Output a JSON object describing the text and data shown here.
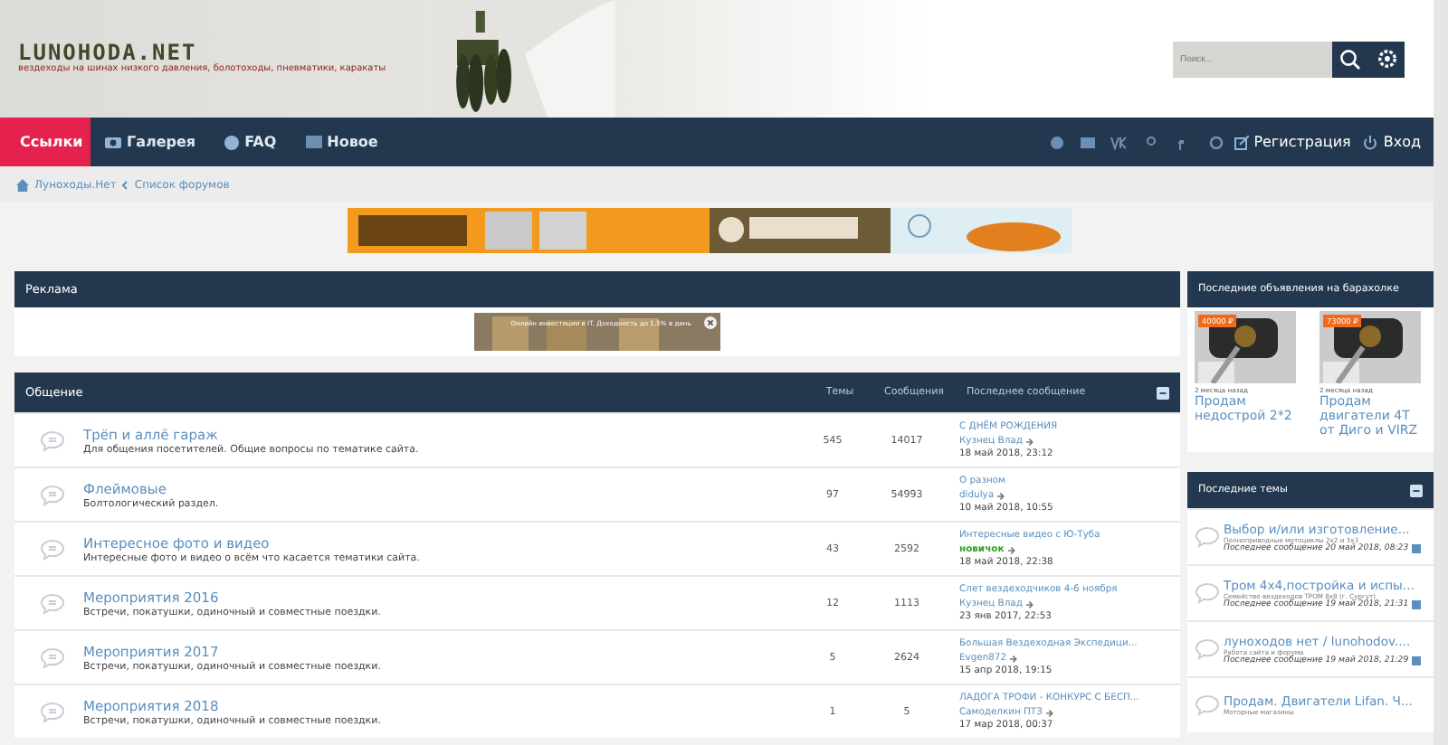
{
  "header": {
    "logo": "LUNOHODA.NET",
    "tagline": "вездеходы на шинах низкого давления, болотоходы, пневматики, каракаты",
    "search": {
      "placeholder": "Поиск..."
    }
  },
  "nav": {
    "items": [
      {
        "label": "Ссылки",
        "selected": true
      },
      {
        "label": "Галерея",
        "selected": false
      },
      {
        "label": "FAQ",
        "selected": false
      },
      {
        "label": "Новое",
        "selected": false
      }
    ],
    "right": [
      {
        "label": "Регистрация"
      },
      {
        "label": "Вход"
      }
    ]
  },
  "breadcrumbs": [
    "Луноходы.Нет",
    "Список форумов"
  ],
  "ads": {
    "title": "Реклама",
    "text": "Онлайн инвестиции в IT. Доходность до 1,5% в день"
  },
  "forum": {
    "title": "Общение",
    "columns": [
      "Темы",
      "Сообщения",
      "Последнее сообщение"
    ],
    "rows": [
      {
        "name": "Трёп и аллё гараж",
        "desc": "Для общения посетителей. Общие вопросы по тематике сайта.",
        "topics": "545",
        "posts": "14017",
        "last": {
          "title": "С ДНЁМ РОЖДЕНИЯ",
          "author": "Кузнец Влад",
          "color": "#5a8fbf",
          "date": "18 май 2018, 23:12"
        }
      },
      {
        "name": "Флеймовые",
        "desc": "Болтологический раздел.",
        "topics": "97",
        "posts": "54993",
        "last": {
          "title": "О разном",
          "author": "didulya",
          "color": "#5a8fbf",
          "date": "10 май 2018, 10:55"
        }
      },
      {
        "name": "Интересное фото и видео",
        "desc": "Интересные фото и видео о всём что касается тематики сайта.",
        "topics": "43",
        "posts": "2592",
        "last": {
          "title": "Интересные видео с Ю-Туба",
          "author": "новичок",
          "color": "#2ea11d",
          "date": "18 май 2018, 22:38"
        }
      },
      {
        "name": "Мероприятия 2016",
        "desc": "Встречи, покатушки, одиночный и совместные поездки.",
        "topics": "12",
        "posts": "1113",
        "last": {
          "title": "Слет вездеходчиков 4-6 ноября",
          "author": "Кузнец Влад",
          "color": "#5a8fbf",
          "date": "23 янв 2017, 22:53"
        }
      },
      {
        "name": "Мероприятия 2017",
        "desc": "Встречи, покатушки, одиночный и совместные поездки.",
        "topics": "5",
        "posts": "2624",
        "last": {
          "title": "Большая Вездеходная Экспедици...",
          "author": "Evgen872",
          "color": "#5a8fbf",
          "date": "15 апр 2018, 19:15"
        }
      },
      {
        "name": "Мероприятия 2018",
        "desc": "Встречи, покатушки, одиночный и совместные поездки.",
        "topics": "1",
        "posts": "5",
        "last": {
          "title": "ЛАДОГА ТРОФИ - КОНКУРС С БЕСП...",
          "author": "Самоделкин ПТЗ",
          "color": "#5a8fbf",
          "date": "17 мар 2018, 00:37"
        }
      }
    ]
  },
  "market": {
    "title": "Последние объявления на барахолке",
    "cards": [
      {
        "price": "40000 ₽",
        "age": "2 месяца назад",
        "title": "Продам недострой 2*2"
      },
      {
        "price": "73000 ₽",
        "age": "2 месяца назад",
        "title": "Продам двигатели 4Т от Диго и VIRZ"
      }
    ]
  },
  "topics": {
    "title": "Последние темы",
    "items": [
      {
        "title": "Выбор и/или изготовление...",
        "forum": "Полноприводные мотоциклы 2х2 и 3х3",
        "last": "Последнее сообщение 20 май 2018, 08:23"
      },
      {
        "title": "Тром 4x4,постройка и испы...",
        "forum": "Семейство вездеходов ТРОМ 8х8 (г. Сургут)",
        "last": "Последнее сообщение 19 май 2018, 21:31"
      },
      {
        "title": "луноходов нет / lunohodov....",
        "forum": "Работа сайта и форума",
        "last": "Последнее сообщение 19 май 2018, 21:29"
      },
      {
        "title": "Продам. Двигатели Lifan. Ч...",
        "forum": "Моторные магазины"
      }
    ]
  }
}
